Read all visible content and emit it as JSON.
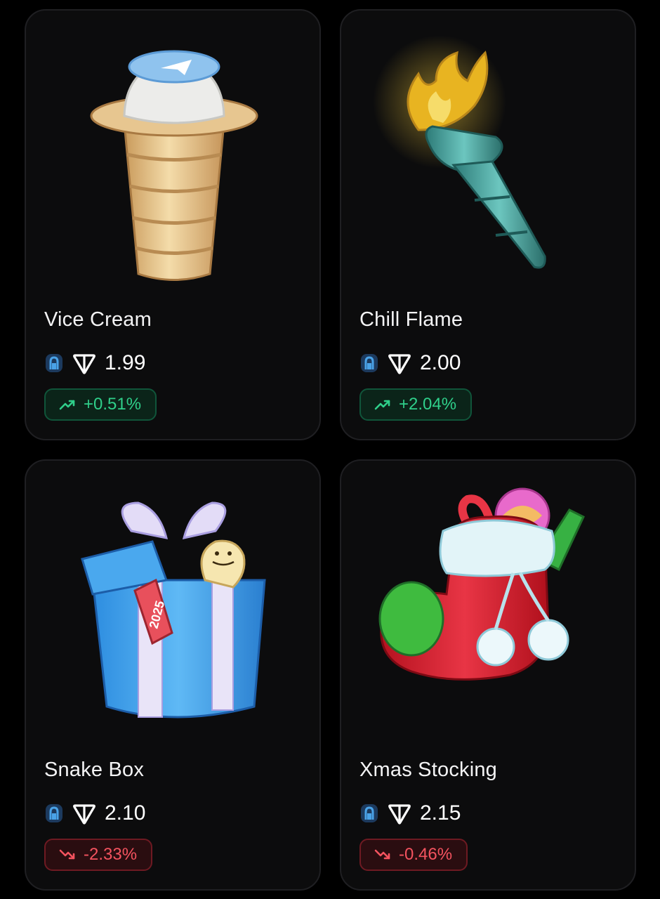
{
  "items": [
    {
      "name": "Vice Cream",
      "price": "1.99",
      "change": "+0.51%",
      "direction": "up",
      "art": "ice-cream-cone-image",
      "currency_icon": "ton-icon"
    },
    {
      "name": "Chill Flame",
      "price": "2.00",
      "change": "+2.04%",
      "direction": "up",
      "art": "torch-image",
      "currency_icon": "ton-icon"
    },
    {
      "name": "Snake Box",
      "price": "2.10",
      "change": "-2.33%",
      "direction": "down",
      "art": "gift-box-snake-image",
      "art_tag": "2025",
      "currency_icon": "ton-icon"
    },
    {
      "name": "Xmas Stocking",
      "price": "2.15",
      "change": "-0.46%",
      "direction": "down",
      "art": "christmas-stocking-image",
      "currency_icon": "ton-icon"
    }
  ],
  "colors": {
    "background": "#000000",
    "card": "#0c0c0d",
    "up": "#2fcf8a",
    "down": "#f4535f"
  }
}
